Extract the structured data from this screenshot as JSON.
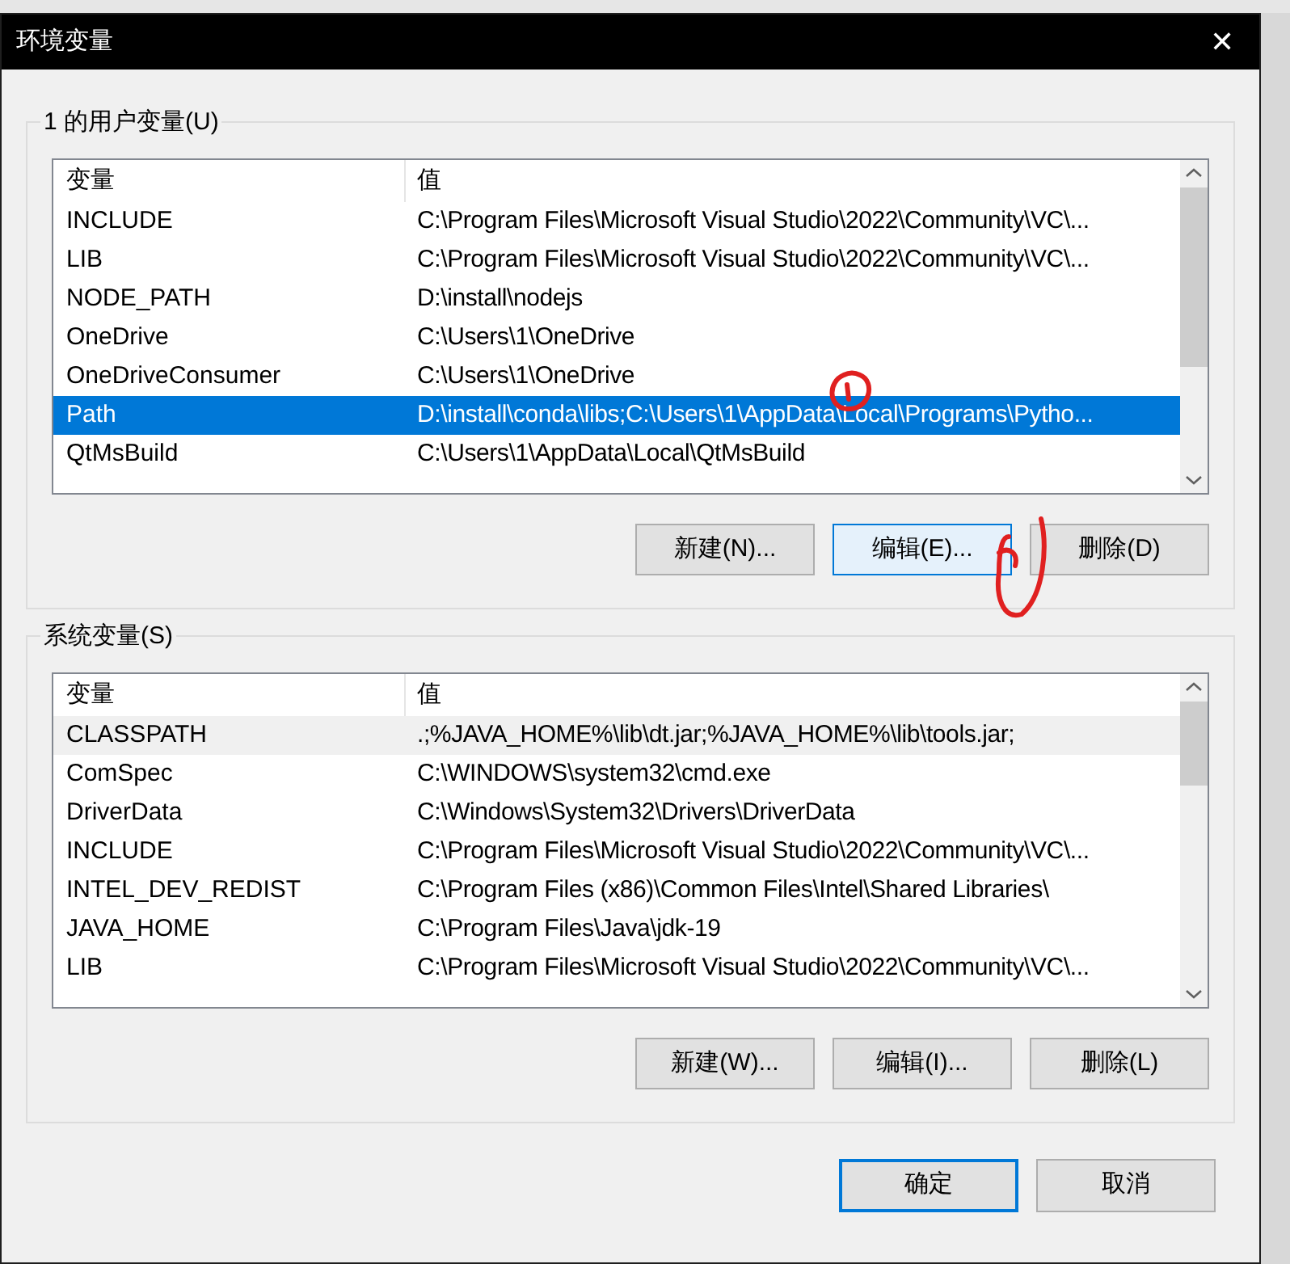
{
  "window": {
    "title": "环境变量",
    "close": "✕"
  },
  "user_variables": {
    "label": "1 的用户变量(U)",
    "focused": true,
    "columns": [
      "变量",
      "值"
    ],
    "rows": [
      {
        "name": "INCLUDE",
        "value": "C:\\Program Files\\Microsoft Visual Studio\\2022\\Community\\VC\\...",
        "selected": false
      },
      {
        "name": "LIB",
        "value": "C:\\Program Files\\Microsoft Visual Studio\\2022\\Community\\VC\\...",
        "selected": false
      },
      {
        "name": "NODE_PATH",
        "value": "D:\\install\\nodejs",
        "selected": false
      },
      {
        "name": "OneDrive",
        "value": "C:\\Users\\1\\OneDrive",
        "selected": false
      },
      {
        "name": "OneDriveConsumer",
        "value": "C:\\Users\\1\\OneDrive",
        "selected": false
      },
      {
        "name": "Path",
        "value": "D:\\install\\conda\\libs;C:\\Users\\1\\AppData\\Local\\Programs\\Pytho...",
        "selected": true
      },
      {
        "name": "QtMsBuild",
        "value": "C:\\Users\\1\\AppData\\Local\\QtMsBuild",
        "selected": false
      }
    ],
    "buttons": [
      {
        "label": "新建(N)...",
        "hovered": false
      },
      {
        "label": "编辑(E)...",
        "hovered": true
      },
      {
        "label": "删除(D)",
        "hovered": false
      }
    ]
  },
  "system_variables": {
    "label": "系统变量(S)",
    "focused": false,
    "columns": [
      "变量",
      "值"
    ],
    "rows": [
      {
        "name": "CLASSPATH",
        "value": ".;%JAVA_HOME%\\lib\\dt.jar;%JAVA_HOME%\\lib\\tools.jar;",
        "selected": true
      },
      {
        "name": "ComSpec",
        "value": "C:\\WINDOWS\\system32\\cmd.exe",
        "selected": false
      },
      {
        "name": "DriverData",
        "value": "C:\\Windows\\System32\\Drivers\\DriverData",
        "selected": false
      },
      {
        "name": "INCLUDE",
        "value": "C:\\Program Files\\Microsoft Visual Studio\\2022\\Community\\VC\\...",
        "selected": false
      },
      {
        "name": "INTEL_DEV_REDIST",
        "value": "C:\\Program Files (x86)\\Common Files\\Intel\\Shared Libraries\\",
        "selected": false
      },
      {
        "name": "JAVA_HOME",
        "value": "C:\\Program Files\\Java\\jdk-19",
        "selected": false
      },
      {
        "name": "LIB",
        "value": "C:\\Program Files\\Microsoft Visual Studio\\2022\\Community\\VC\\...",
        "selected": false
      }
    ],
    "buttons": [
      {
        "label": "新建(W)...",
        "hovered": false
      },
      {
        "label": "编辑(I)...",
        "hovered": false
      },
      {
        "label": "删除(L)",
        "hovered": false
      }
    ]
  },
  "footer_buttons": [
    {
      "label": "确定",
      "default": true
    },
    {
      "label": "取消",
      "default": false
    }
  ]
}
